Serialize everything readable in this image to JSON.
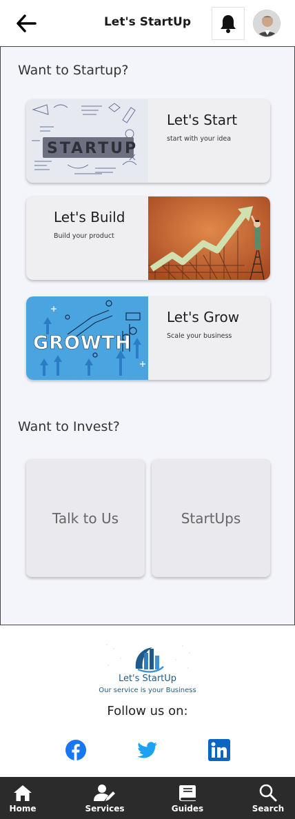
{
  "header": {
    "title": "Let's StartUp",
    "back_icon": "arrow-left-icon",
    "bell_icon": "bell-icon",
    "avatar_icon": "user-avatar"
  },
  "startup_section": {
    "title": "Want to Startup?",
    "cards": [
      {
        "title": "Let's Start",
        "subtitle": "start with your idea",
        "image": "startup-sketch-image"
      },
      {
        "title": "Let's Build",
        "subtitle": "Build your product",
        "image": "growth-chart-image"
      },
      {
        "title": "Let's Grow",
        "subtitle": "Scale your business",
        "image": "growth-arrows-image",
        "image_word": "GROWTH"
      }
    ]
  },
  "invest_section": {
    "title": "Want to Invest?",
    "tiles": [
      {
        "label": "Talk to Us"
      },
      {
        "label": "StartUps"
      }
    ]
  },
  "footer": {
    "brand_name": "Let's StartUp",
    "tagline": "Our service is your Business",
    "follow_label": "Follow us on:",
    "social": [
      "facebook-icon",
      "twitter-icon",
      "linkedin-icon"
    ]
  },
  "bottom_nav": {
    "items": [
      {
        "label": "Home",
        "icon": "home-icon"
      },
      {
        "label": "Services",
        "icon": "services-icon"
      },
      {
        "label": "Guides",
        "icon": "book-icon"
      },
      {
        "label": "Search",
        "icon": "search-icon"
      }
    ]
  },
  "colors": {
    "main_bg": "#f4f5fa",
    "card_bg": "#efeff2",
    "brand_blue": "#1f5b8a",
    "facebook": "#1877f2",
    "twitter": "#1da1f2",
    "linkedin": "#0a66c2",
    "nav_bg": "#2b2b2b"
  }
}
